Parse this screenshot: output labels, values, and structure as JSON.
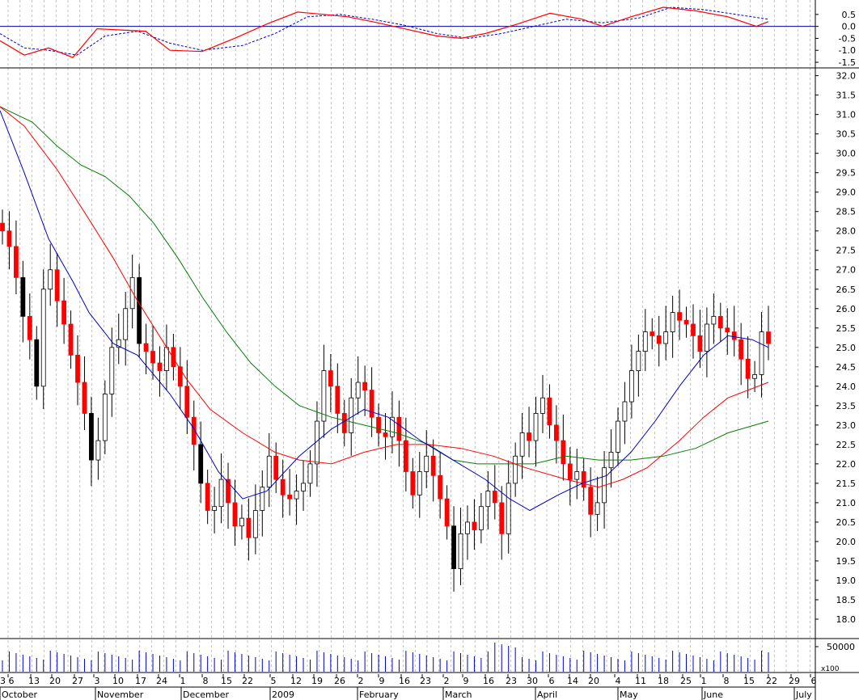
{
  "chart_data": {
    "type": "candlestick",
    "colors": {
      "grid": "#9a9a9a",
      "up_candle_fill": "#ffffff",
      "down_candle_fill": "#ff0000",
      "big_down_candle_fill": "#000000",
      "ma_short": "#0000cc",
      "ma_medium": "#ff0000",
      "ma_long": "#008000",
      "oscillator_line": "#ff0000",
      "oscillator_signal": "#0000cc",
      "zero_line": "#0000aa",
      "volume": "#0000cc"
    },
    "oscillator": {
      "tick_labels": [
        "0.5",
        "0.0",
        "-0.5",
        "-1.0",
        "-1.5"
      ],
      "ticks": [
        0.5,
        0.0,
        -0.5,
        -1.0,
        -1.5
      ],
      "ylim": [
        -1.6,
        0.9
      ],
      "line_points": [
        [
          0,
          -0.6
        ],
        [
          30,
          -1.2
        ],
        [
          60,
          -0.9
        ],
        [
          90,
          -1.3
        ],
        [
          120,
          -0.1
        ],
        [
          150,
          -0.15
        ],
        [
          180,
          -0.2
        ],
        [
          210,
          -1.0
        ],
        [
          250,
          -1.05
        ],
        [
          290,
          -0.5
        ],
        [
          330,
          0.1
        ],
        [
          368,
          0.6
        ],
        [
          400,
          0.5
        ],
        [
          430,
          0.4
        ],
        [
          460,
          0.2
        ],
        [
          500,
          -0.1
        ],
        [
          540,
          -0.4
        ],
        [
          570,
          -0.5
        ],
        [
          600,
          -0.3
        ],
        [
          640,
          0.1
        ],
        [
          680,
          0.55
        ],
        [
          720,
          0.3
        ],
        [
          745,
          0.0
        ],
        [
          780,
          0.4
        ],
        [
          820,
          0.8
        ],
        [
          860,
          0.65
        ],
        [
          900,
          0.4
        ],
        [
          935,
          0.0
        ],
        [
          950,
          0.2
        ]
      ],
      "signal_points": [
        [
          0,
          -0.3
        ],
        [
          30,
          -0.9
        ],
        [
          60,
          -1.0
        ],
        [
          95,
          -1.2
        ],
        [
          130,
          -0.4
        ],
        [
          170,
          -0.2
        ],
        [
          210,
          -0.7
        ],
        [
          250,
          -1.0
        ],
        [
          300,
          -0.8
        ],
        [
          340,
          -0.3
        ],
        [
          380,
          0.4
        ],
        [
          420,
          0.5
        ],
        [
          460,
          0.3
        ],
        [
          500,
          0.05
        ],
        [
          540,
          -0.3
        ],
        [
          580,
          -0.5
        ],
        [
          620,
          -0.3
        ],
        [
          660,
          0.0
        ],
        [
          700,
          0.3
        ],
        [
          745,
          0.15
        ],
        [
          790,
          0.35
        ],
        [
          830,
          0.8
        ],
        [
          870,
          0.7
        ],
        [
          910,
          0.5
        ],
        [
          950,
          0.3
        ]
      ]
    },
    "price": {
      "tick_labels": [
        "32.0",
        "31.5",
        "31.0",
        "30.5",
        "30.0",
        "29.5",
        "29.0",
        "28.5",
        "28.0",
        "27.5",
        "27.0",
        "26.5",
        "26.0",
        "25.5",
        "25.0",
        "24.5",
        "24.0",
        "23.5",
        "23.0",
        "22.5",
        "22.0",
        "21.5",
        "21.0",
        "20.5",
        "20.0",
        "19.5",
        "19.0",
        "18.5",
        "18.0"
      ],
      "ticks": [
        32.0,
        31.5,
        31.0,
        30.5,
        30.0,
        29.5,
        29.0,
        28.5,
        28.0,
        27.5,
        27.0,
        26.5,
        26.0,
        25.5,
        25.0,
        24.5,
        24.0,
        23.5,
        23.0,
        22.5,
        22.0,
        21.5,
        21.0,
        20.5,
        20.0,
        19.5,
        19.0,
        18.5,
        18.0
      ],
      "ylim": [
        17.5,
        32.2
      ],
      "candles_close": [
        28.0,
        27.6,
        26.8,
        25.8,
        25.2,
        24.0,
        26.5,
        27.0,
        26.2,
        25.6,
        24.8,
        24.1,
        23.3,
        22.1,
        22.6,
        23.8,
        25.0,
        25.2,
        26.0,
        26.8,
        25.1,
        24.9,
        24.6,
        24.4,
        25.0,
        24.5,
        24.0,
        23.2,
        22.5,
        21.5,
        20.8,
        20.9,
        21.6,
        21.0,
        20.4,
        20.6,
        20.1,
        20.8,
        21.4,
        22.2,
        21.6,
        21.2,
        21.1,
        21.3,
        21.5,
        22.0,
        23.1,
        24.4,
        24.0,
        23.3,
        22.8,
        23.7,
        24.1,
        23.9,
        23.2,
        22.8,
        22.7,
        23.2,
        22.6,
        21.8,
        21.2,
        21.8,
        22.2,
        21.7,
        21.1,
        20.4,
        19.3,
        20.2,
        20.5,
        20.3,
        20.9,
        21.3,
        21.0,
        20.2,
        21.5,
        22.2,
        22.8,
        22.6,
        23.3,
        23.7,
        23.0,
        22.6,
        22.0,
        21.6,
        21.8,
        21.4,
        20.7,
        21.0,
        21.9,
        22.3,
        23.1,
        23.6,
        24.4,
        24.9,
        25.4,
        25.3,
        25.1,
        25.4,
        25.9,
        25.7,
        25.6,
        25.3,
        24.9,
        25.6,
        25.8,
        25.5,
        25.4,
        25.2,
        24.7,
        24.2,
        24.3,
        25.4,
        25.1
      ],
      "ma_short_points": [
        [
          0,
          31.1
        ],
        [
          30,
          29.5
        ],
        [
          60,
          27.8
        ],
        [
          90,
          26.7
        ],
        [
          110,
          25.9
        ],
        [
          140,
          25.1
        ],
        [
          170,
          24.8
        ],
        [
          210,
          23.8
        ],
        [
          240,
          22.9
        ],
        [
          270,
          21.8
        ],
        [
          300,
          21.1
        ],
        [
          330,
          21.3
        ],
        [
          370,
          22.2
        ],
        [
          410,
          22.9
        ],
        [
          450,
          23.4
        ],
        [
          480,
          23.2
        ],
        [
          520,
          22.6
        ],
        [
          560,
          22.1
        ],
        [
          600,
          21.6
        ],
        [
          630,
          21.1
        ],
        [
          655,
          20.8
        ],
        [
          690,
          21.2
        ],
        [
          720,
          21.5
        ],
        [
          750,
          21.7
        ],
        [
          780,
          22.3
        ],
        [
          810,
          23.1
        ],
        [
          840,
          24.0
        ],
        [
          870,
          24.8
        ],
        [
          900,
          25.3
        ],
        [
          930,
          25.2
        ],
        [
          950,
          25.0
        ]
      ],
      "ma_medium_points": [
        [
          0,
          31.2
        ],
        [
          30,
          30.7
        ],
        [
          70,
          29.6
        ],
        [
          110,
          28.3
        ],
        [
          140,
          27.3
        ],
        [
          170,
          26.2
        ],
        [
          200,
          25.2
        ],
        [
          230,
          24.2
        ],
        [
          260,
          23.4
        ],
        [
          300,
          22.8
        ],
        [
          340,
          22.3
        ],
        [
          370,
          22.1
        ],
        [
          410,
          22.0
        ],
        [
          450,
          22.3
        ],
        [
          490,
          22.5
        ],
        [
          530,
          22.5
        ],
        [
          570,
          22.4
        ],
        [
          610,
          22.2
        ],
        [
          650,
          21.9
        ],
        [
          700,
          21.6
        ],
        [
          740,
          21.4
        ],
        [
          770,
          21.6
        ],
        [
          800,
          21.9
        ],
        [
          840,
          22.6
        ],
        [
          870,
          23.2
        ],
        [
          900,
          23.7
        ],
        [
          950,
          24.1
        ]
      ],
      "ma_long_points": [
        [
          0,
          31.2
        ],
        [
          40,
          30.8
        ],
        [
          70,
          30.2
        ],
        [
          100,
          29.7
        ],
        [
          130,
          29.4
        ],
        [
          160,
          28.9
        ],
        [
          190,
          28.2
        ],
        [
          220,
          27.3
        ],
        [
          250,
          26.3
        ],
        [
          280,
          25.4
        ],
        [
          310,
          24.6
        ],
        [
          340,
          24.0
        ],
        [
          370,
          23.5
        ],
        [
          410,
          23.2
        ],
        [
          450,
          23.0
        ],
        [
          490,
          22.8
        ],
        [
          530,
          22.5
        ],
        [
          560,
          22.1
        ],
        [
          590,
          22.0
        ],
        [
          630,
          22.0
        ],
        [
          660,
          22.0
        ],
        [
          700,
          22.2
        ],
        [
          740,
          22.1
        ],
        [
          780,
          22.1
        ],
        [
          820,
          22.2
        ],
        [
          860,
          22.4
        ],
        [
          900,
          22.8
        ],
        [
          950,
          23.1
        ]
      ]
    },
    "volume": {
      "tick_labels": [
        "50000"
      ],
      "unit_label": "x100"
    },
    "x_axis": {
      "day_labels": [
        "6",
        "13",
        "20",
        "27",
        "3",
        "10",
        "17",
        "24",
        "1",
        "8",
        "15",
        "22",
        "5",
        "12",
        "19",
        "26",
        "2",
        "9",
        "16",
        "23",
        "2",
        "9",
        "16",
        "23",
        "30",
        "6",
        "14",
        "20",
        "4",
        "11",
        "18",
        "25",
        "1",
        "8",
        "15",
        "22",
        "29",
        "6"
      ],
      "month_labels": [
        "October",
        "November",
        "December",
        "2009",
        "February",
        "March",
        "April",
        "May",
        "June",
        "July"
      ],
      "first_partial_day_label": "3"
    }
  }
}
